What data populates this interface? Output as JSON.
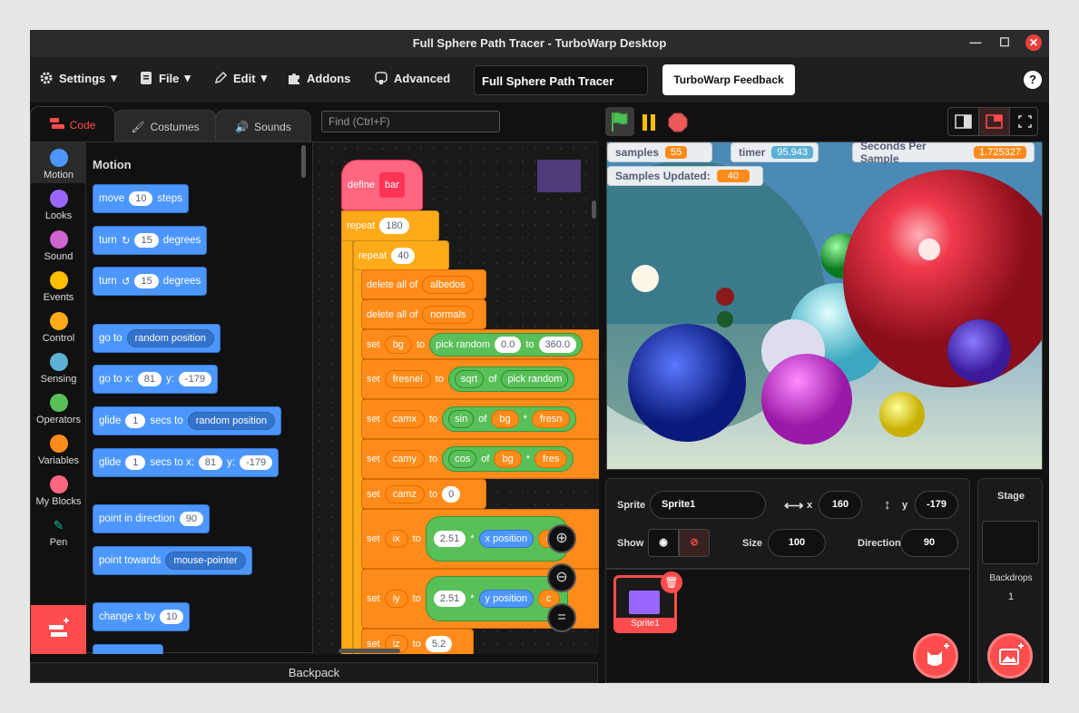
{
  "window": {
    "title": "Full Sphere Path Tracer - TurboWarp Desktop"
  },
  "menu": {
    "settings": "Settings",
    "file": "File",
    "edit": "Edit",
    "addons": "Addons",
    "advanced": "Advanced",
    "project_title": "Full Sphere Path Tracer",
    "feedback": "TurboWarp Feedback",
    "help": "?"
  },
  "tabs": {
    "code": "Code",
    "costumes": "Costumes",
    "sounds": "Sounds"
  },
  "find": {
    "placeholder": "Find (Ctrl+F)"
  },
  "categories": [
    {
      "label": "Motion",
      "color": "#4c97ff"
    },
    {
      "label": "Looks",
      "color": "#9966ff"
    },
    {
      "label": "Sound",
      "color": "#cf63cf"
    },
    {
      "label": "Events",
      "color": "#ffbf00"
    },
    {
      "label": "Control",
      "color": "#ffab19"
    },
    {
      "label": "Sensing",
      "color": "#5cb1d6"
    },
    {
      "label": "Operators",
      "color": "#59c059"
    },
    {
      "label": "Variables",
      "color": "#ff8c1a"
    },
    {
      "label": "My Blocks",
      "color": "#ff6680"
    },
    {
      "label": "Pen",
      "color": "#0fbd8c"
    }
  ],
  "palette": {
    "title": "Motion",
    "move": {
      "a": "move",
      "n": "10",
      "b": "steps"
    },
    "turn_right": {
      "a": "turn",
      "n": "15",
      "b": "degrees"
    },
    "turn_left": {
      "a": "turn",
      "n": "15",
      "b": "degrees"
    },
    "goto": {
      "a": "go to",
      "d": "random position"
    },
    "gotoxy": {
      "a": "go to x:",
      "x": "81",
      "b": "y:",
      "y": "-179"
    },
    "glide": {
      "a": "glide",
      "n": "1",
      "b": "secs to",
      "d": "random position"
    },
    "glidexy": {
      "a": "glide",
      "n": "1",
      "b": "secs to x:",
      "x": "81",
      "c": "y:",
      "y": "-179"
    },
    "point_dir": {
      "a": "point in direction",
      "n": "90"
    },
    "point_towards": {
      "a": "point towards",
      "d": "mouse-pointer"
    },
    "change_x": {
      "a": "change x by",
      "n": "10"
    }
  },
  "script": {
    "define": "define",
    "define_name": "bar",
    "repeat1": {
      "a": "repeat",
      "n": "180"
    },
    "repeat2": {
      "a": "repeat",
      "n": "40"
    },
    "del1": {
      "a": "delete all of",
      "d": "albedos"
    },
    "del2": {
      "a": "delete all of",
      "d": "normals"
    },
    "set_bg": {
      "a": "set",
      "v": "bg",
      "to": "to",
      "op": "pick random",
      "n1": "0.0",
      "mid": "to",
      "n2": "360.0"
    },
    "set_fresnel": {
      "a": "set",
      "v": "fresnel",
      "to": "to",
      "fn": "sqrt",
      "of": "of",
      "op": "pick random"
    },
    "set_camx": {
      "a": "set",
      "v": "camx",
      "to": "to",
      "fn": "sin",
      "of": "of",
      "arg": "bg",
      "times": "*",
      "arg2": "fresn"
    },
    "set_camy": {
      "a": "set",
      "v": "camy",
      "to": "to",
      "fn": "cos",
      "of": "of",
      "arg": "bg",
      "times": "*",
      "arg2": "fres"
    },
    "set_camz": {
      "a": "set",
      "v": "camz",
      "to": "to",
      "n": "0"
    },
    "set_ix": {
      "a": "set",
      "v": "ix",
      "to": "to",
      "n": "2.51",
      "times": "*",
      "sens": "x position",
      "c": "c"
    },
    "set_iy": {
      "a": "set",
      "v": "iy",
      "to": "to",
      "n": "2.51",
      "times": "*",
      "sens": "y position",
      "c": "c"
    },
    "set_iz": {
      "a": "set",
      "v": "iz",
      "to": "to",
      "n": "5.2"
    }
  },
  "backpack": "Backpack",
  "monitors": {
    "samples": {
      "label": "samples",
      "value": "55"
    },
    "timer": {
      "label": "timer",
      "value": "95.943"
    },
    "sps": {
      "label": "Seconds Per Sample",
      "value": "1.725327"
    },
    "updated": {
      "label": "Samples Updated:",
      "value": "40"
    }
  },
  "sprite_info": {
    "sprite_label": "Sprite",
    "sprite_name": "Sprite1",
    "x_label": "x",
    "x": "160",
    "y_label": "y",
    "y": "-179",
    "show_label": "Show",
    "size_label": "Size",
    "size": "100",
    "direction_label": "Direction",
    "direction": "90"
  },
  "sprites": [
    {
      "name": "Sprite1"
    }
  ],
  "stage_panel": {
    "title": "Stage",
    "backdrops_label": "Backdrops",
    "backdrops_count": "1"
  }
}
